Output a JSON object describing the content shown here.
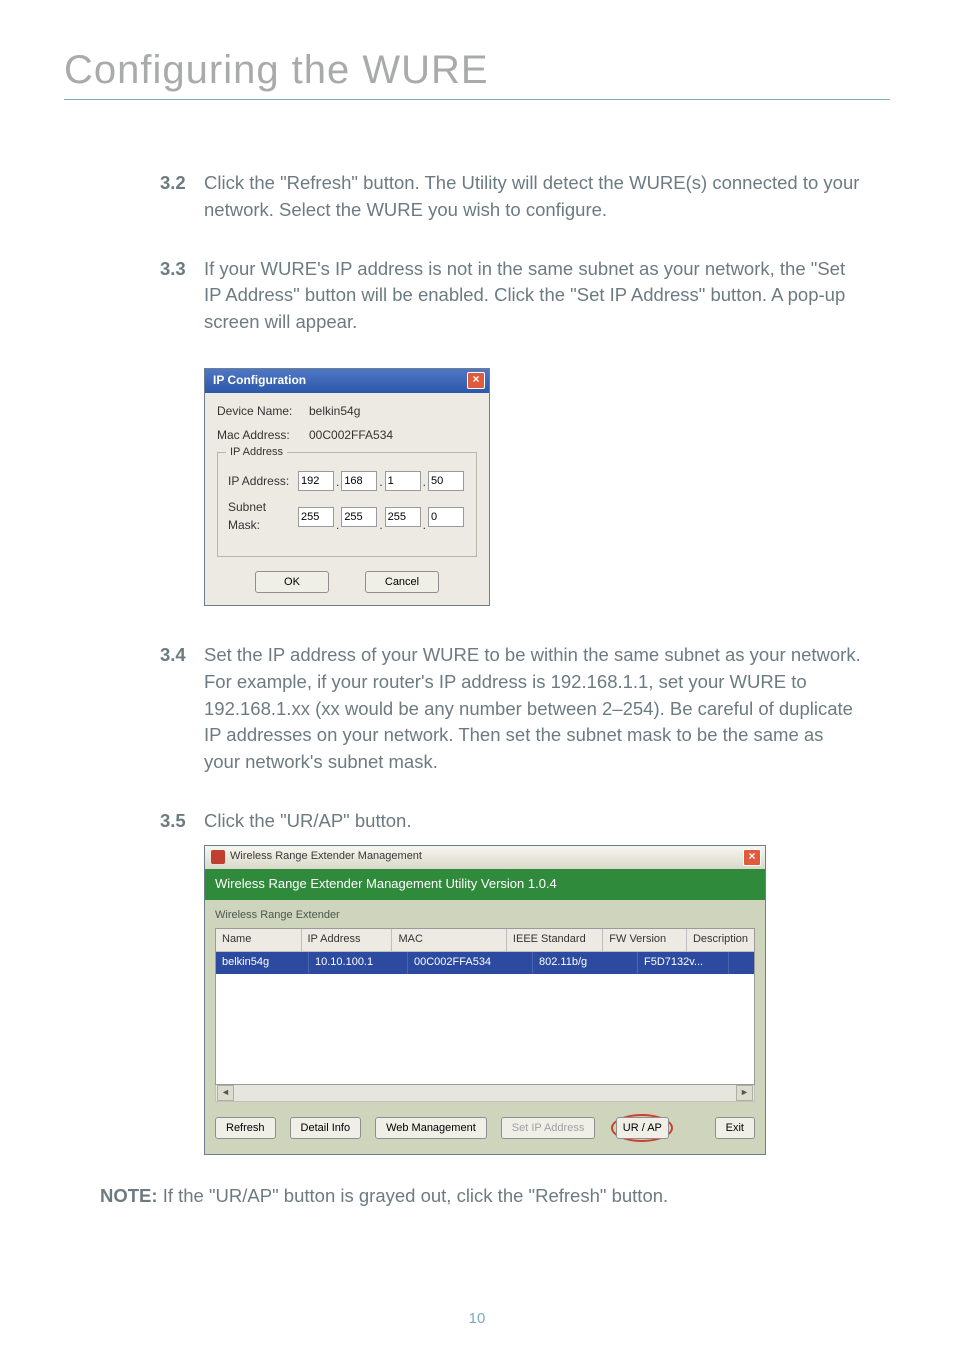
{
  "page": {
    "heading": "Configuring the WURE",
    "page_number": "10"
  },
  "steps": {
    "s32": {
      "num": "3.2",
      "text": "Click the \"Refresh\" button. The Utility will detect the WURE(s) connected to your network. Select the WURE you wish to configure."
    },
    "s33": {
      "num": "3.3",
      "text": "If your WURE's IP address is not in the same subnet as your network, the \"Set IP Address\" button will be enabled. Click the \"Set IP Address\" button. A pop-up screen will appear."
    },
    "s34": {
      "num": "3.4",
      "text": "Set the IP address of your WURE to be within the same subnet as your network. For example, if your router's IP address is 192.168.1.1, set your WURE to 192.168.1.xx  (xx would be any number between 2–254). Be careful of duplicate IP addresses on your network. Then set the subnet mask to be the same as your network's subnet mask."
    },
    "s35": {
      "num": "3.5",
      "text": "Click the \"UR/AP\" button."
    }
  },
  "dialog": {
    "title": "IP Configuration",
    "device_name_label": "Device Name:",
    "device_name_value": "belkin54g",
    "mac_label": "Mac Address:",
    "mac_value": "00C002FFA534",
    "group_label": "IP Address",
    "ip_label": "IP Address:",
    "ip": [
      "192",
      "168",
      "1",
      "50"
    ],
    "mask_label": "Subnet Mask:",
    "mask": [
      "255",
      "255",
      "255",
      "0"
    ],
    "ok": "OK",
    "cancel": "Cancel"
  },
  "mgr": {
    "title": "Wireless Range Extender Management",
    "banner": "Wireless Range Extender Management Utility Version 1.0.4",
    "sublabel": "Wireless Range Extender",
    "headers": {
      "name": "Name",
      "ip": "IP Address",
      "mac": "MAC",
      "ieee": "IEEE Standard",
      "fw": "FW Version",
      "desc": "Description"
    },
    "row": {
      "name": "belkin54g",
      "ip": "10.10.100.1",
      "mac": "00C002FFA534",
      "ieee": "802.11b/g",
      "fw": "F5D7132v...",
      "desc": ""
    },
    "buttons": {
      "refresh": "Refresh",
      "detail": "Detail Info",
      "web": "Web Management",
      "setip": "Set IP Address",
      "urap": "UR / AP",
      "exit": "Exit"
    }
  },
  "note": {
    "strong": "NOTE:",
    "text": " If the \"UR/AP\" button is grayed out, click the \"Refresh\" button."
  }
}
